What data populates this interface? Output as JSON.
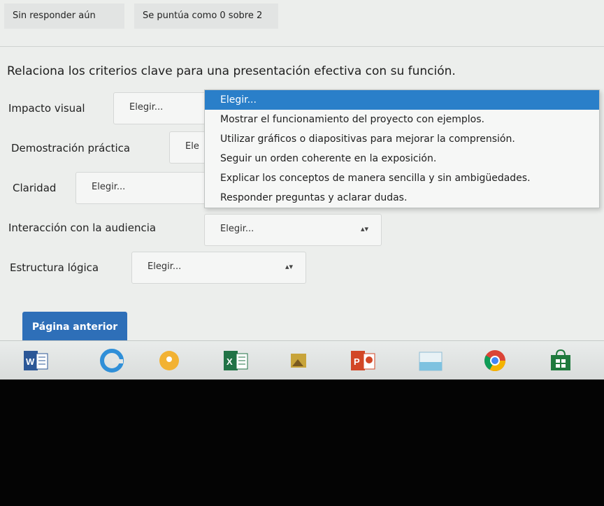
{
  "status": {
    "answer_state": "Sin responder aún",
    "score": "Se puntúa como 0 sobre 2"
  },
  "question": {
    "text": "Relaciona los criterios clave para una presentación efectiva con su función."
  },
  "rows": [
    {
      "label": "Impacto visual",
      "select_value": "Elegir..."
    },
    {
      "label": "Demostración práctica",
      "select_value": "Ele"
    },
    {
      "label": "Claridad",
      "select_value": "Elegir..."
    },
    {
      "label": "Interacción con la audiencia",
      "select_value": "Elegir..."
    },
    {
      "label": "Estructura lógica",
      "select_value": "Elegir..."
    }
  ],
  "dropdown": {
    "options": [
      "Elegir...",
      "Mostrar el funcionamiento del proyecto con ejemplos.",
      "Utilizar gráficos o diapositivas para mejorar la comprensión.",
      "Seguir un orden coherente en la exposición.",
      "Explicar los conceptos de manera sencilla y sin ambigüedades.",
      "Responder preguntas y aclarar dudas."
    ]
  },
  "navigation": {
    "previous_page": "Página anterior"
  },
  "taskbar": {
    "items": [
      "word-icon",
      "edge-icon",
      "maps-icon",
      "excel-icon",
      "photos-icon",
      "powerpoint-icon",
      "paint-icon",
      "chrome-icon",
      "store-icon"
    ],
    "word_letter": "W",
    "excel_letter": "X",
    "powerpoint_letter": "P"
  },
  "colors": {
    "accent": "#2a7fc9",
    "button": "#2e6fb8"
  }
}
